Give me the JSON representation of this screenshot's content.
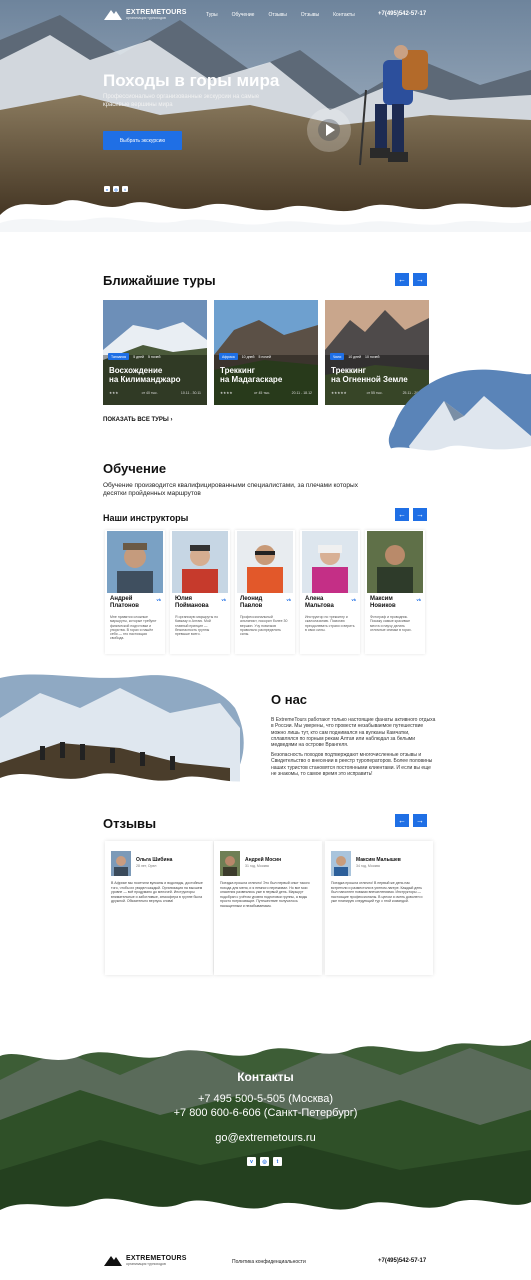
{
  "brand": {
    "name": "EXTREMETOURS",
    "tagline": "организация турпоходов"
  },
  "nav": {
    "items": [
      "Туры",
      "Обучение",
      "Отзывы",
      "Отзывы",
      "Контакты"
    ]
  },
  "header": {
    "phone": "+7(495)542-57-17"
  },
  "hero": {
    "title": "Походы в горы мира",
    "subtitle": "Профессионально организованные экскурсии на самые красивые вершины мира",
    "cta": "Выбрать экскурсию",
    "social": [
      "vk-icon",
      "instagram-icon",
      "twitter-icon"
    ]
  },
  "tours": {
    "title": "Ближайшие туры",
    "show_all": "ПОКАЗАТЬ ВСЕ ТУРЫ",
    "items": [
      {
        "name_line1": "Восхождение",
        "name_line2": "на Килиманджаро",
        "tag": "Танзания",
        "meta1": "5 дней",
        "meta2": "5 ночей",
        "price": "от 40 тыс.",
        "dates": "10.11 - 30.11"
      },
      {
        "name_line1": "Треккинг",
        "name_line2": "на Мадагаскаре",
        "tag": "Африка",
        "meta1": "10 дней",
        "meta2": "5 ночей",
        "price": "от 45 тыс.",
        "dates": "20.11 - 18.12"
      },
      {
        "name_line1": "Треккинг",
        "name_line2": "на Огненной Земле",
        "tag": "Чили",
        "meta1": "10 дней",
        "meta2": "10 ночей",
        "price": "от 55 тыс.",
        "dates": "25.11 - 29.12"
      }
    ]
  },
  "education": {
    "title": "Обучение",
    "text": "Обучение производится квалифицированными специалистами, за плечами которых десятки пройденных маршрутов",
    "instructors_title": "Наши инструкторы",
    "instructors": [
      {
        "first": "Андрей",
        "last": "Платонов",
        "text": "Мне нравятся сложные маршруты, которые требуют физической подготовки и упорства. В горах я нашёл себя — это настоящая свобода."
      },
      {
        "first": "Юлия",
        "last": "Пойманова",
        "text": "Я организую маршруты по Кавказу и Алтаю. Мой главный принцип — безопасность группы превыше всего."
      },
      {
        "first": "Леонид",
        "last": "Павлов",
        "text": "Профессиональный альпинист, покорил более 30 вершин. Учу новичков правильно распределять силы."
      },
      {
        "first": "Алена",
        "last": "Мальтова",
        "text": "Инструктор по треккингу и скалолазанию. Помогаю преодолевать страхи и верить в свои силы."
      },
      {
        "first": "Максим",
        "last": "Новиков",
        "text": "Фотограф и проводник. Покажу самые красивые места и научу делать отличные снимки в горах."
      }
    ]
  },
  "about": {
    "title": "О нас",
    "p1": "В ExtremeTours работают только настоящие фанаты активного отдыха в России. Мы уверены, что провести незабываемое путешествие можно лишь тут, кто сам поднимался на вулканы Камчатки, сплавлялся по горным рекам Алтая или наблюдал за белыми медведями на острове Врангеля.",
    "p2": "Безопасность походов подтверждают многочисленные отзывы и Свидетельство о внесении в реестр туроператоров. Более половины наших туристов становятся постоянными клиентами. И если вы еще не знакомы, то самое время это исправить!"
  },
  "reviews": {
    "title": "Отзывы",
    "items": [
      {
        "name": "Ольга Шибина",
        "meta": "28 лет, Орел",
        "text": "В Африке мы посетили вулканы и водопады, достойные того, чтобы их увидел каждый. Организация на высшем уровне — всё продумано до мелочей. Инструкторы внимательные и заботливые, атмосфера в группе была дружной. Обязательно вернусь снова!"
      },
      {
        "name": "Андрей Мосин",
        "meta": "31 год, Москва",
        "text": "Поездка прошла отлично! Это был первый опыт такого похода для меня, и я немного переживал. Но все мои опасения развеялись уже в первый день. Маршрут подобран с учётом уровня подготовки группы, а виды просто потрясающие. Путешествие получилось насыщенным и незабываемым."
      },
      {
        "name": "Максим Малышев",
        "meta": "34 год, Москва",
        "text": "Поездка прошла отлично! В первый же день нас встретили и разместили в уютном лагере. Каждый день был наполнен новыми впечатлениями. Инструкторы — настоящие профессионалы. В целом я очень доволен и уже планирую следующий тур с этой командой."
      }
    ]
  },
  "contacts": {
    "title": "Контакты",
    "phone_moscow": "+7 495 500-5-505 (Москва)",
    "phone_spb": "+7 800 600-6-606 (Санкт-Петербург)",
    "email": "go@extremetours.ru"
  },
  "footer": {
    "policy": "Политика конфиденциальности",
    "phone": "+7(495)542-57-17"
  },
  "colors": {
    "accent": "#1f6fe5"
  }
}
